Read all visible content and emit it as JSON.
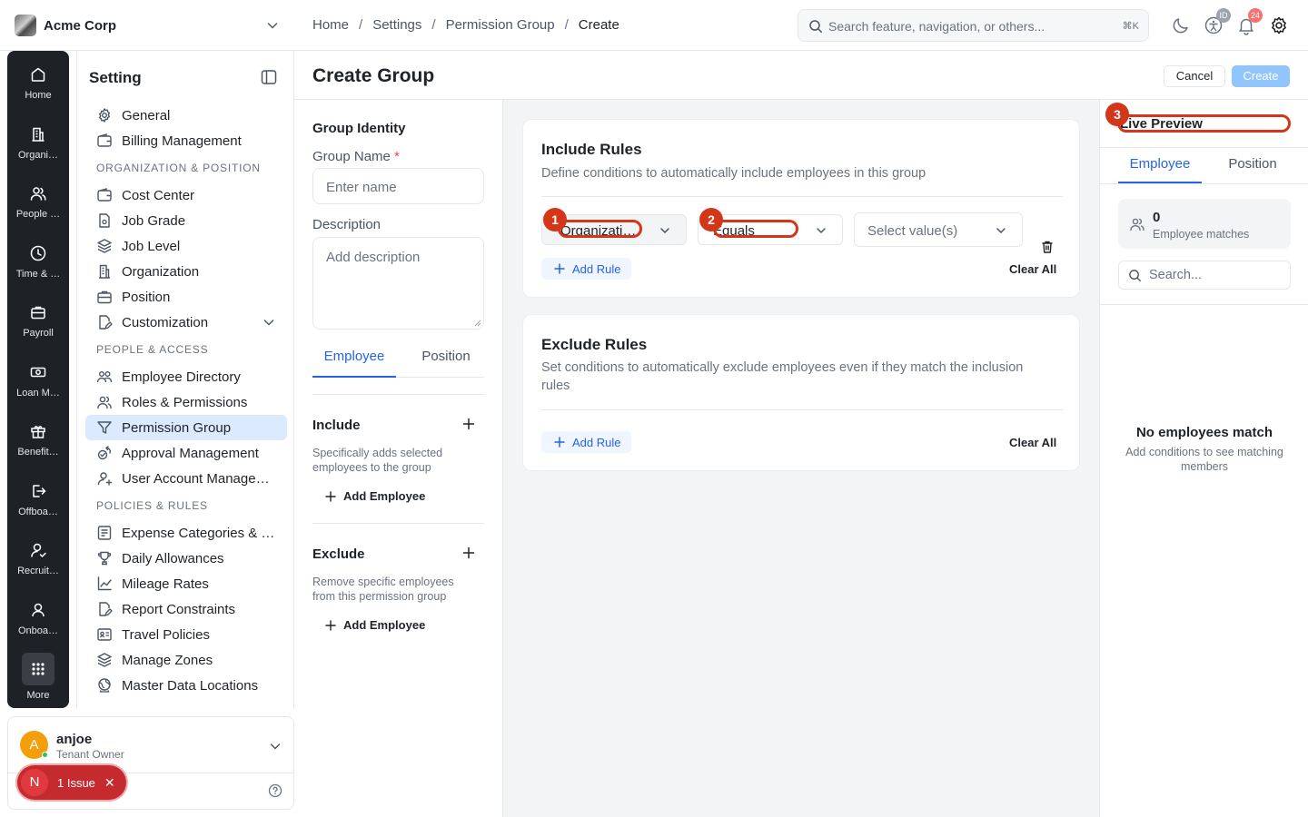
{
  "topbar": {
    "org_name": "Acme Corp",
    "breadcrumbs": [
      "Home",
      "Settings",
      "Permission Group",
      "Create"
    ],
    "breadcrumb_separator": "/",
    "search_placeholder": "Search feature, navigation, or others...",
    "search_shortcut": "⌘K",
    "id_badge": "ID",
    "notification_count": "24"
  },
  "rail": {
    "items": [
      {
        "label": "Home",
        "icon": "home-icon"
      },
      {
        "label": "Organi…",
        "icon": "building-icon"
      },
      {
        "label": "People …",
        "icon": "people-icon"
      },
      {
        "label": "Time & …",
        "icon": "clock-icon"
      },
      {
        "label": "Payroll",
        "icon": "briefcase-icon"
      },
      {
        "label": "Loan M…",
        "icon": "cash-icon"
      },
      {
        "label": "Benefit…",
        "icon": "gift-icon"
      },
      {
        "label": "Offboa…",
        "icon": "logout-icon"
      },
      {
        "label": "Recruit…",
        "icon": "user-check-icon"
      },
      {
        "label": "Onboa…",
        "icon": "user-icon"
      },
      {
        "label": "More",
        "icon": "grid-icon"
      }
    ]
  },
  "sidebar": {
    "title": "Setting",
    "items_top": [
      {
        "label": "General",
        "icon": "gear-icon"
      },
      {
        "label": "Billing Management",
        "icon": "wallet-icon"
      }
    ],
    "section_org": "ORGANIZATION & POSITION",
    "items_org": [
      {
        "label": "Cost Center",
        "icon": "wallet-icon"
      },
      {
        "label": "Job Grade",
        "icon": "document-icon"
      },
      {
        "label": "Job Level",
        "icon": "layers-icon"
      },
      {
        "label": "Organization",
        "icon": "building-icon"
      },
      {
        "label": "Position",
        "icon": "briefcase-icon"
      },
      {
        "label": "Customization",
        "icon": "edit-doc-icon"
      }
    ],
    "section_people": "PEOPLE & ACCESS",
    "items_people": [
      {
        "label": "Employee Directory",
        "icon": "people-icon"
      },
      {
        "label": "Roles & Permissions",
        "icon": "people-icon"
      },
      {
        "label": "Permission Group",
        "icon": "filter-icon"
      },
      {
        "label": "Approval Management",
        "icon": "approval-icon"
      },
      {
        "label": "User Account Management",
        "icon": "user-icon"
      }
    ],
    "section_policies": "POLICIES & RULES",
    "items_policies": [
      {
        "label": "Expense Categories & …",
        "icon": "list-icon"
      },
      {
        "label": "Daily Allowances",
        "icon": "trophy-icon"
      },
      {
        "label": "Mileage Rates",
        "icon": "chart-icon"
      },
      {
        "label": "Report Constraints",
        "icon": "edit-doc-icon"
      },
      {
        "label": "Travel Policies",
        "icon": "id-card-icon"
      },
      {
        "label": "Manage Zones",
        "icon": "layers-icon"
      },
      {
        "label": "Master Data Locations",
        "icon": "globe-icon"
      }
    ]
  },
  "user": {
    "initial": "A",
    "name": "anjoe",
    "role": "Tenant Owner"
  },
  "issue": {
    "letter": "N",
    "text": "1 Issue",
    "close": "✕"
  },
  "main": {
    "title": "Create Group",
    "cancel_label": "Cancel",
    "create_label": "Create"
  },
  "form": {
    "identity_heading": "Group Identity",
    "group_name_label": "Group Name",
    "required_mark": "*",
    "group_name_placeholder": "Enter name",
    "description_label": "Description",
    "description_placeholder": "Add description",
    "tabs": [
      "Employee",
      "Position"
    ],
    "include_heading": "Include",
    "include_desc": "Specifically adds selected employees to the group",
    "include_add": "Add Employee",
    "exclude_heading": "Exclude",
    "exclude_desc": "Remove specific employees from this permission group",
    "exclude_add": "Add Employee"
  },
  "include_rules": {
    "title": "Include Rules",
    "description": "Define conditions to automatically include employees in this group",
    "field_value": "Organizati…",
    "operator_value": "Equals",
    "value_placeholder": "Select value(s)",
    "add_rule": "Add Rule",
    "clear_all": "Clear All"
  },
  "exclude_rules": {
    "title": "Exclude Rules",
    "description": "Set conditions to automatically exclude employees even if they match the inclusion rules",
    "add_rule": "Add Rule",
    "clear_all": "Clear All"
  },
  "preview": {
    "title": "Live Preview",
    "tabs": [
      "Employee",
      "Position"
    ],
    "match_count": "0",
    "match_label": "Employee matches",
    "search_placeholder": "Search...",
    "empty_title": "No employees match",
    "empty_desc": "Add conditions to see matching members"
  },
  "annotations": [
    "1",
    "2",
    "3"
  ],
  "colors": {
    "accent": "#2563eb",
    "rail_bg": "#1e2227",
    "active_item_bg": "#dbeafe",
    "create_disabled": "#93c5fd",
    "annotation_red": "#d4361a",
    "issue_red": "#c52a2f"
  }
}
